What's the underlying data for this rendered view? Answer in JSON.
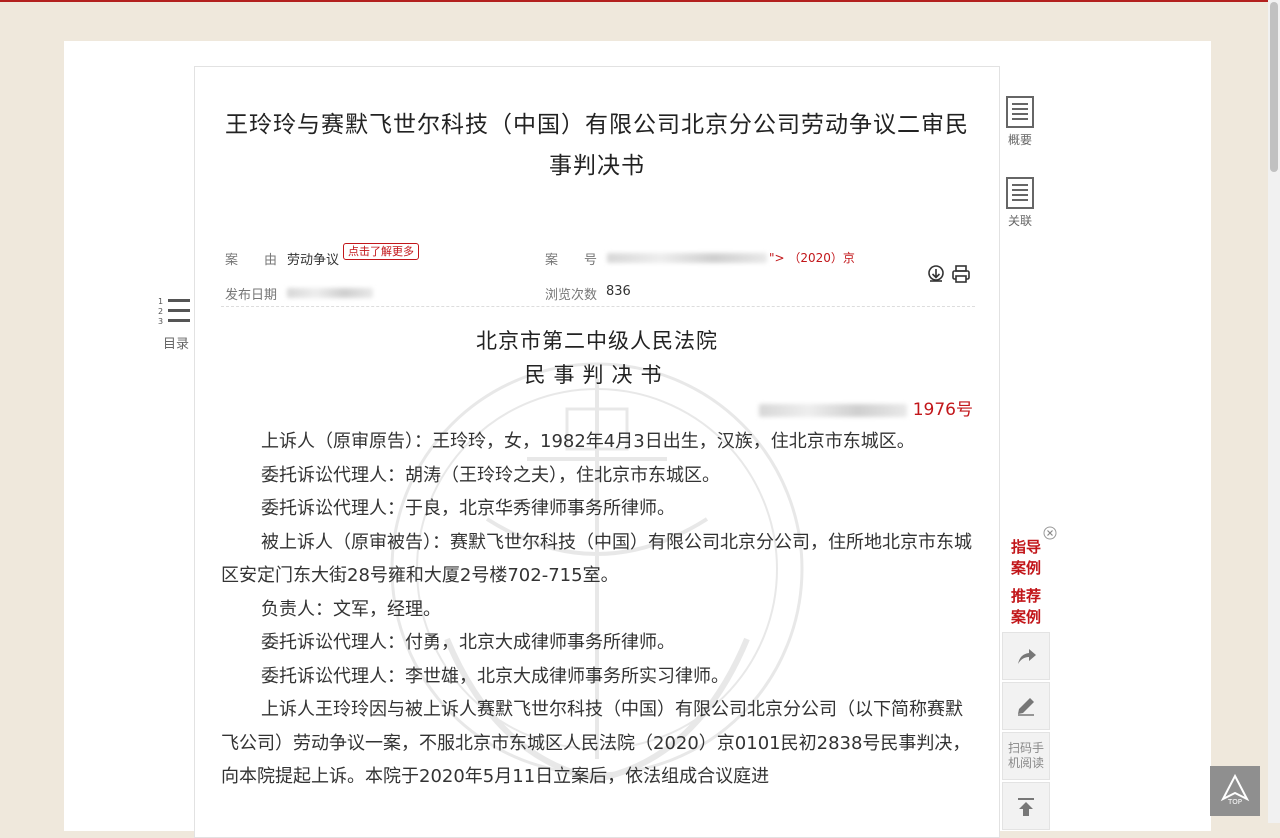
{
  "document": {
    "title": "王玲玲与赛默飞世尔科技（中国）有限公司北京分公司劳动争议二审民事判决书",
    "cause_label": "案　　由",
    "cause_value": "劳动争议",
    "learn_more": "点击了解更多",
    "case_no_label": "案　　号",
    "case_no_value": "\"> （2020）京",
    "publish_label": "发布日期",
    "views_label": "浏览次数",
    "views_value": "836"
  },
  "sidebar": {
    "summary": "概要",
    "related": "关联",
    "toc": "目录"
  },
  "recommend": {
    "guide": [
      "指导",
      "案例"
    ],
    "recommended": [
      "推荐",
      "案例"
    ],
    "scan": [
      "扫码手",
      "机阅读"
    ],
    "top": "TOP"
  },
  "content": {
    "court": "北京市第二中级人民法院",
    "doc_type": "民事判决书",
    "case_no_end": "1976号",
    "paragraphs": [
      "上诉人（原审原告）：王玲玲，女，1982年4月3日出生，汉族，住北京市东城区。",
      "委托诉讼代理人：胡涛（王玲玲之夫），住北京市东城区。",
      "委托诉讼代理人：于良，北京华秀律师事务所律师。",
      "被上诉人（原审被告）：赛默飞世尔科技（中国）有限公司北京分公司，住所地北京市东城区安定门东大街28号雍和大厦2号楼702-715室。",
      "负责人：文军，经理。",
      "委托诉讼代理人：付勇，北京大成律师事务所律师。",
      "委托诉讼代理人：李世雄，北京大成律师事务所实习律师。",
      "上诉人王玲玲因与被上诉人赛默飞世尔科技（中国）有限公司北京分公司（以下简称赛默飞公司）劳动争议一案，不服北京市东城区人民法院（2020）京0101民初2838号民事判决，向本院提起上诉。本院于2020年5月11日立案后，依法组成合议庭进"
    ]
  }
}
